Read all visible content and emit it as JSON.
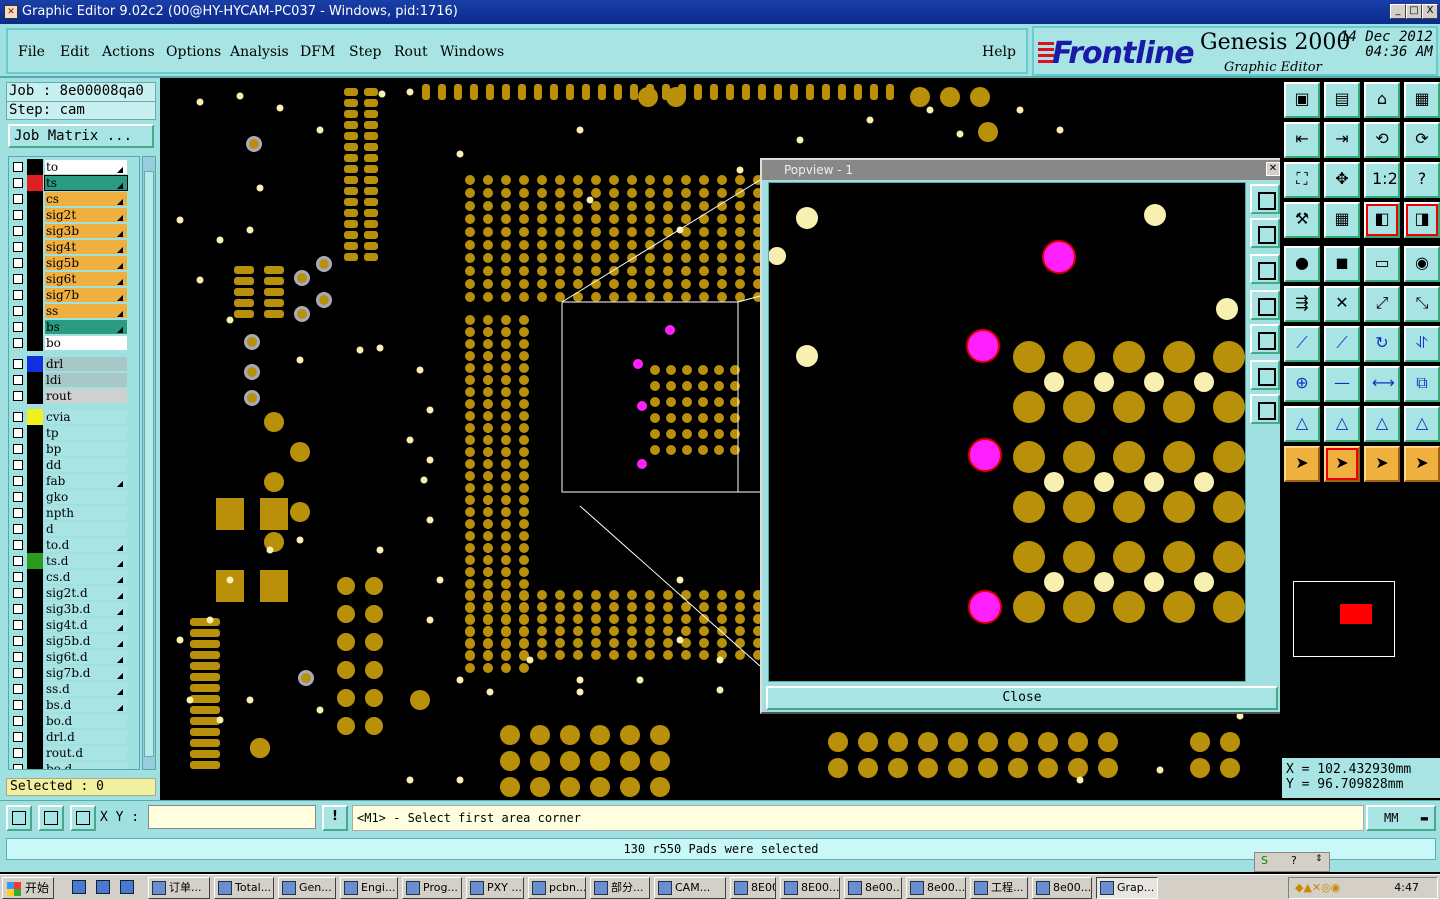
{
  "window": {
    "title": "Graphic Editor 9.02c2 (00@HY-HYCAM-PC037 - Windows, pid:1716)",
    "controls": [
      "_",
      "□",
      "X"
    ]
  },
  "menu": {
    "items": [
      "File",
      "Edit",
      "Actions",
      "Options",
      "Analysis",
      "DFM",
      "Step",
      "Rout",
      "Windows"
    ],
    "help": "Help"
  },
  "brand": {
    "logo": "Frontline",
    "product": "Genesis 2000",
    "subtitle": "Graphic Editor",
    "date": "14 Dec 2012",
    "time": "04:36 AM"
  },
  "job": {
    "job_line": "Job : 8e00008qa0",
    "step_line": "Step: cam",
    "matrix_button": "Job Matrix ..."
  },
  "layers": [
    {
      "name": "to",
      "color": "#ffffff",
      "swatch": "#000000",
      "arrow": true
    },
    {
      "name": "ts",
      "color": "#2a9a80",
      "swatch": "#e02020",
      "arrow": true,
      "active": true
    },
    {
      "name": "cs",
      "color": "#f0b040",
      "swatch": "#000000",
      "arrow": true
    },
    {
      "name": "sig2t",
      "color": "#f0b040",
      "swatch": "#000000",
      "arrow": true
    },
    {
      "name": "sig3b",
      "color": "#f0b040",
      "swatch": "#000000",
      "arrow": true
    },
    {
      "name": "sig4t",
      "color": "#f0b040",
      "swatch": "#000000",
      "arrow": true
    },
    {
      "name": "sig5b",
      "color": "#f0b040",
      "swatch": "#000000",
      "arrow": true
    },
    {
      "name": "sig6t",
      "color": "#f0b040",
      "swatch": "#000000",
      "arrow": true
    },
    {
      "name": "sig7b",
      "color": "#f0b040",
      "swatch": "#000000",
      "arrow": true
    },
    {
      "name": "ss",
      "color": "#f0b040",
      "swatch": "#000000",
      "arrow": true
    },
    {
      "name": "bs",
      "color": "#2a9a80",
      "swatch": "#000000",
      "arrow": true
    },
    {
      "name": "bo",
      "color": "#ffffff",
      "swatch": "#000000",
      "arrow": false
    },
    {
      "name": "drl",
      "color": "#a8c8c8",
      "swatch": "#1030e0",
      "arrow": false
    },
    {
      "name": "ldi",
      "color": "#a8c8c8",
      "swatch": "#000000",
      "arrow": false
    },
    {
      "name": "rout",
      "color": "#d0d0d0",
      "swatch": "#000000",
      "arrow": false
    },
    {
      "name": "cvia",
      "color": "#a8e4e4",
      "swatch": "#f0f020",
      "arrow": false
    },
    {
      "name": "tp",
      "color": "#a8e4e4",
      "swatch": "#000000",
      "arrow": false
    },
    {
      "name": "bp",
      "color": "#a8e4e4",
      "swatch": "#000000",
      "arrow": false
    },
    {
      "name": "dd",
      "color": "#a8e4e4",
      "swatch": "#000000",
      "arrow": false
    },
    {
      "name": "fab",
      "color": "#a8e4e4",
      "swatch": "#000000",
      "arrow": true
    },
    {
      "name": "gko",
      "color": "#a8e4e4",
      "swatch": "#000000",
      "arrow": false
    },
    {
      "name": "npth",
      "color": "#a8e4e4",
      "swatch": "#000000",
      "arrow": false
    },
    {
      "name": "d",
      "color": "#a8e4e4",
      "swatch": "#000000",
      "arrow": false
    },
    {
      "name": "to.d",
      "color": "#a8e4e4",
      "swatch": "#000000",
      "arrow": true
    },
    {
      "name": "ts.d",
      "color": "#a8e4e4",
      "swatch": "#2a9a20",
      "arrow": true
    },
    {
      "name": "cs.d",
      "color": "#a8e4e4",
      "swatch": "#000000",
      "arrow": true
    },
    {
      "name": "sig2t.d",
      "color": "#a8e4e4",
      "swatch": "#000000",
      "arrow": true
    },
    {
      "name": "sig3b.d",
      "color": "#a8e4e4",
      "swatch": "#000000",
      "arrow": true
    },
    {
      "name": "sig4t.d",
      "color": "#a8e4e4",
      "swatch": "#000000",
      "arrow": true
    },
    {
      "name": "sig5b.d",
      "color": "#a8e4e4",
      "swatch": "#000000",
      "arrow": true
    },
    {
      "name": "sig6t.d",
      "color": "#a8e4e4",
      "swatch": "#000000",
      "arrow": true
    },
    {
      "name": "sig7b.d",
      "color": "#a8e4e4",
      "swatch": "#000000",
      "arrow": true
    },
    {
      "name": "ss.d",
      "color": "#a8e4e4",
      "swatch": "#000000",
      "arrow": true
    },
    {
      "name": "bs.d",
      "color": "#a8e4e4",
      "swatch": "#000000",
      "arrow": true
    },
    {
      "name": "bo.d",
      "color": "#a8e4e4",
      "swatch": "#000000",
      "arrow": false
    },
    {
      "name": "drl.d",
      "color": "#a8e4e4",
      "swatch": "#000000",
      "arrow": false
    },
    {
      "name": "rout.d",
      "color": "#a8e4e4",
      "swatch": "#000000",
      "arrow": false
    },
    {
      "name": "bo.d",
      "color": "#a8e4e4",
      "swatch": "#000000",
      "arrow": false
    }
  ],
  "selected": "Selected : 0",
  "popview": {
    "title": "Popview - 1",
    "close": "Close"
  },
  "coords": {
    "x": "X  =  102.432930mm",
    "y": "Y  =  96.709828mm"
  },
  "command": {
    "xy_label": "X Y :",
    "xy_value": "",
    "prompt": "<M1> - Select first area corner",
    "units": "MM"
  },
  "message": "130 r550 Pads were selected",
  "taskbar": {
    "start": "开始",
    "tasks": [
      "订单...",
      "Total...",
      "Gen...",
      "Engi...",
      "Prog...",
      "PXY ...",
      "pcbn...",
      "部分...",
      "CAM...",
      "8E00...",
      "8E00...",
      "8e00...",
      "8e00...",
      "工程...",
      "8e00...",
      "Grap..."
    ],
    "clock": "4:47"
  },
  "colors": {
    "copper": "#b8900a",
    "via_light": "#f8f0b0",
    "magenta": "#ff20ff",
    "panel": "#a0e0e0"
  }
}
